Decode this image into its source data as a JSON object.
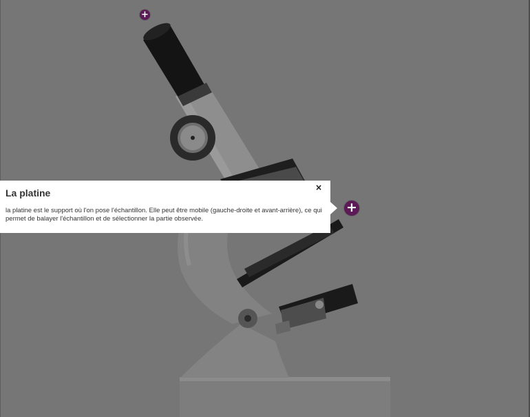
{
  "hotspots": [
    {
      "icon": "plus-icon",
      "symbol": "+"
    },
    {
      "icon": "plus-icon",
      "symbol": "+"
    }
  ],
  "popup": {
    "title": "La platine",
    "body": "la platine est le support où l'on pose l'échantillon. Elle peut être mobile (gauche-droite et avant-arrière), ce qui permet de balayer l'échantillon et de sélectionner la partie observée.",
    "close_symbol": "×",
    "close_icon": "close-icon"
  },
  "colors": {
    "overlay": "#767676",
    "hotspot": "#5c1b57",
    "popup_background": "#ffffff",
    "text": "#333333"
  }
}
